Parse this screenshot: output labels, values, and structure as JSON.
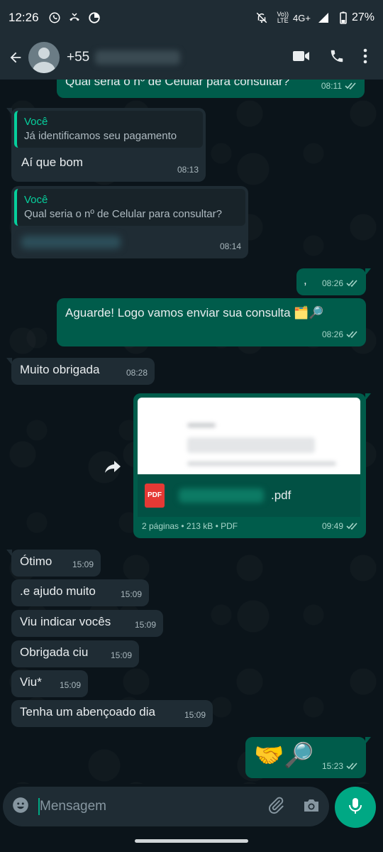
{
  "status_bar": {
    "time": "12:26",
    "network_label": "4G+",
    "network_top": "Vo))",
    "network_bottom": "LTE",
    "battery": "27%"
  },
  "header": {
    "contact_prefix": "+55"
  },
  "messages": [
    {
      "id": "m0",
      "direction": "out",
      "text": "Qual seria o nº de Celular para consultar?",
      "time": "08:11"
    },
    {
      "id": "m1",
      "direction": "in",
      "quote_author": "Você",
      "quote_text": "Já identificamos seu pagamento",
      "text": "Aí que bom",
      "time": "08:13"
    },
    {
      "id": "m2",
      "direction": "in",
      "quote_author": "Você",
      "quote_text": "Qual seria o nº de Celular para consultar?",
      "time": "08:14"
    },
    {
      "id": "m3",
      "direction": "out",
      "text": ",",
      "time": "08:26"
    },
    {
      "id": "m4",
      "direction": "out",
      "text": "Aguarde! Logo vamos enviar sua consulta 🗂️🔎",
      "time": "08:26"
    },
    {
      "id": "m5",
      "direction": "in",
      "text": "Muito obrigada",
      "time": "08:28"
    },
    {
      "id": "m6",
      "direction": "out",
      "type": "document",
      "file_ext": ".pdf",
      "file_badge": "PDF",
      "file_info": "2 páginas • 213 kB • PDF",
      "time": "09:49"
    },
    {
      "id": "m7",
      "direction": "in",
      "text": "Ótimo",
      "time": "15:09"
    },
    {
      "id": "m8",
      "direction": "in",
      "text": ".e ajudo muito",
      "time": "15:09"
    },
    {
      "id": "m9",
      "direction": "in",
      "text": "Viu indicar vocês",
      "time": "15:09"
    },
    {
      "id": "m10",
      "direction": "in",
      "text": "Obrigada ciu",
      "time": "15:09"
    },
    {
      "id": "m11",
      "direction": "in",
      "text": "Viu*",
      "time": "15:09"
    },
    {
      "id": "m12",
      "direction": "in",
      "text": "Tenha um abençoado dia",
      "time": "15:09"
    },
    {
      "id": "m13",
      "direction": "out",
      "text": "🤝🔎",
      "time": "15:23"
    }
  ],
  "composer": {
    "placeholder": "Mensagem"
  },
  "icons": {
    "back": "arrow-left-icon",
    "video": "video-call-icon",
    "phone": "phone-icon",
    "menu": "more-vert-icon",
    "emoji": "emoji-icon",
    "attach": "attach-icon",
    "camera": "camera-icon",
    "mic": "mic-icon",
    "forward": "forward-icon"
  },
  "colors": {
    "incoming_bubble": "#1f2c34",
    "outgoing_bubble": "#005c4b",
    "accent": "#00a884",
    "quote_accent": "#06cf9c"
  }
}
